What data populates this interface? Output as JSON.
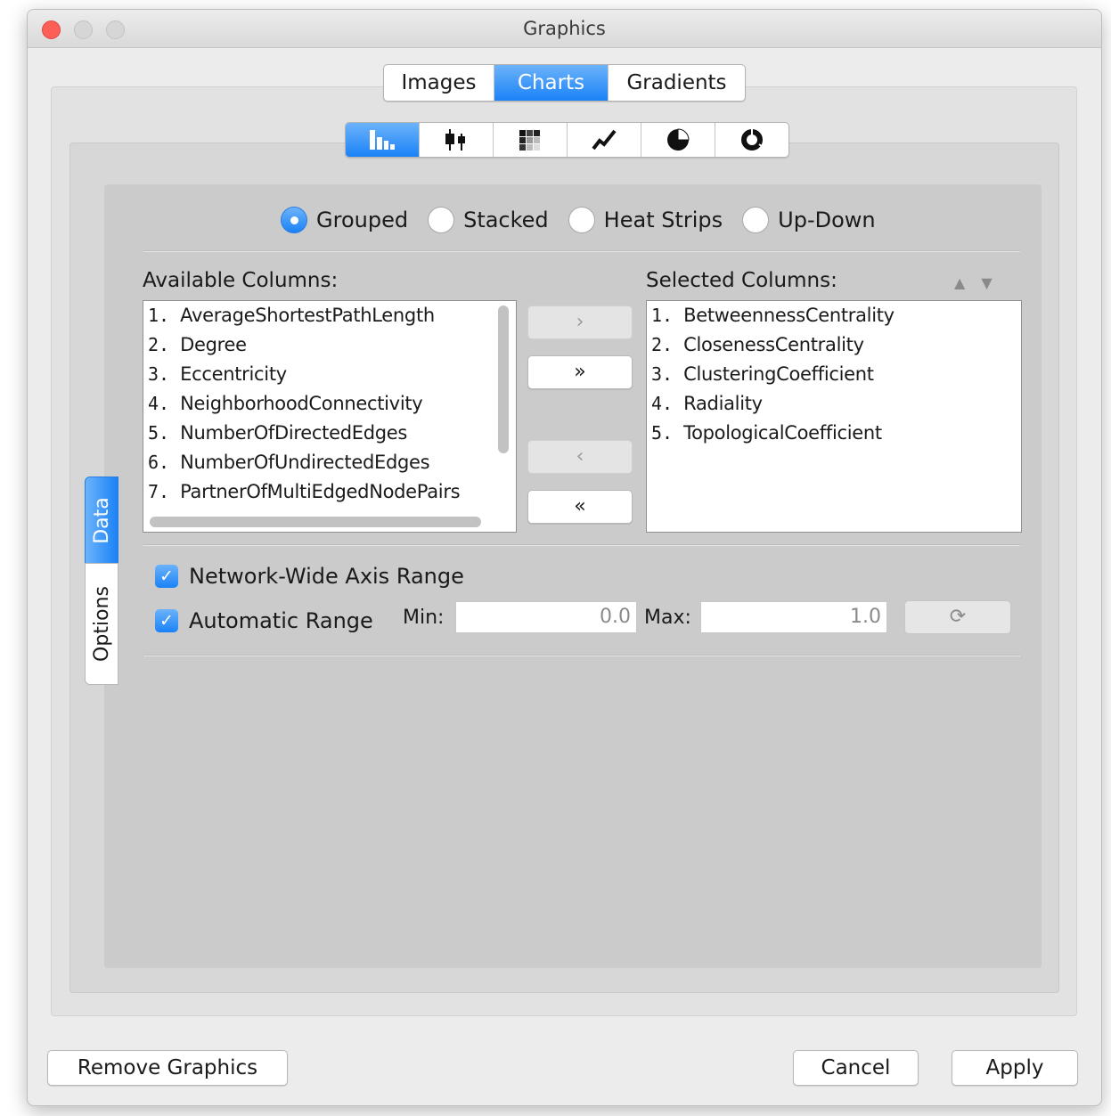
{
  "window": {
    "title": "Graphics"
  },
  "top_tabs": [
    {
      "label": "Images"
    },
    {
      "label": "Charts",
      "active": true
    },
    {
      "label": "Gradients"
    }
  ],
  "chart_types": [
    {
      "icon": "bar-chart-icon",
      "active": true
    },
    {
      "icon": "box-plot-icon"
    },
    {
      "icon": "heat-map-icon"
    },
    {
      "icon": "line-chart-icon"
    },
    {
      "icon": "pie-chart-icon"
    },
    {
      "icon": "ring-chart-icon"
    }
  ],
  "side_tabs": {
    "data": "Data",
    "options": "Options"
  },
  "layout_options": [
    {
      "label": "Grouped",
      "checked": true
    },
    {
      "label": "Stacked"
    },
    {
      "label": "Heat Strips"
    },
    {
      "label": "Up-Down"
    }
  ],
  "available": {
    "label": "Available Columns:",
    "items": [
      {
        "num": "1.",
        "name": "AverageShortestPathLength"
      },
      {
        "num": "2.",
        "name": "Degree"
      },
      {
        "num": "3.",
        "name": "Eccentricity"
      },
      {
        "num": "4.",
        "name": "NeighborhoodConnectivity"
      },
      {
        "num": "5.",
        "name": "NumberOfDirectedEdges"
      },
      {
        "num": "6.",
        "name": "NumberOfUndirectedEdges"
      },
      {
        "num": "7.",
        "name": "PartnerOfMultiEdgedNodePairs"
      }
    ]
  },
  "selected": {
    "label": "Selected Columns:",
    "items": [
      {
        "num": "1.",
        "name": "BetweennessCentrality"
      },
      {
        "num": "2.",
        "name": "ClosenessCentrality"
      },
      {
        "num": "3.",
        "name": "ClusteringCoefficient"
      },
      {
        "num": "4.",
        "name": "Radiality"
      },
      {
        "num": "5.",
        "name": "TopologicalCoefficient"
      }
    ]
  },
  "move_buttons": {
    "add": "›",
    "add_all": "»",
    "remove": "‹",
    "remove_all": "«"
  },
  "sort_arrows": {
    "up": "▲",
    "down": "▼"
  },
  "range": {
    "network_wide_label": "Network-Wide Axis Range",
    "network_wide_checked": true,
    "automatic_label": "Automatic Range",
    "automatic_checked": true,
    "min_label": "Min:",
    "min_value": "0.0",
    "max_label": "Max:",
    "max_value": "1.0",
    "refresh_icon": "refresh-icon"
  },
  "buttons": {
    "remove_graphics": "Remove Graphics",
    "cancel": "Cancel",
    "apply": "Apply"
  },
  "colors": {
    "accent": "#1a82f7",
    "close": "#fd5f57"
  }
}
